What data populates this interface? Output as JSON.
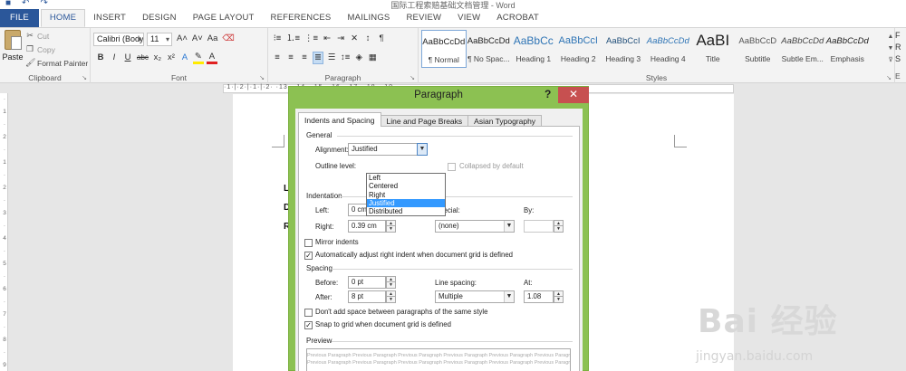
{
  "window": {
    "title": "国际工程索赔基础文档管理 - Word",
    "qat_icons": [
      "save-icon",
      "undo-icon",
      "redo-icon"
    ]
  },
  "ribbon_tabs": [
    "FILE",
    "HOME",
    "INSERT",
    "DESIGN",
    "PAGE LAYOUT",
    "REFERENCES",
    "MAILINGS",
    "REVIEW",
    "VIEW",
    "ACROBAT"
  ],
  "active_tab": "HOME",
  "clipboard": {
    "paste": "Paste",
    "cut": "Cut",
    "copy": "Copy",
    "format_painter": "Format Painter",
    "label": "Clipboard"
  },
  "font": {
    "name": "Calibri (Body)",
    "size": "11",
    "grow": "A˄",
    "shrink": "A˅",
    "case": "Aa",
    "bold": "B",
    "italic": "I",
    "underline": "U",
    "strike": "abc",
    "subscript": "x₂",
    "superscript": "x²",
    "label": "Font"
  },
  "paragraph": {
    "show_marks": "¶",
    "label": "Paragraph"
  },
  "styles": {
    "items": [
      {
        "preview": "AaBbCcDd",
        "name": "¶ Normal"
      },
      {
        "preview": "AaBbCcDd",
        "name": "¶ No Spac..."
      },
      {
        "preview": "AaBbCc",
        "name": "Heading 1"
      },
      {
        "preview": "AaBbCcI",
        "name": "Heading 2"
      },
      {
        "preview": "AaBbCcI",
        "name": "Heading 3"
      },
      {
        "preview": "AaBbCcDd",
        "name": "Heading 4"
      },
      {
        "preview": "AaBI",
        "name": "Title"
      },
      {
        "preview": "AaBbCcD",
        "name": "Subtitle"
      },
      {
        "preview": "AaBbCcDd",
        "name": "Subtle Em..."
      },
      {
        "preview": "AaBbCcDd",
        "name": "Emphasis"
      }
    ],
    "selected_index": 0,
    "label": "Styles"
  },
  "editing": {
    "find": "F",
    "replace": "R",
    "select": "S",
    "label": "E"
  },
  "ruler": {
    "numbers": "·1·|·2·|·1·|·2·   ·13· ·14· ·15· ·16· ·17· ·18· ·19"
  },
  "document": {
    "letters": [
      "Lo",
      "D",
      "R"
    ]
  },
  "dialog": {
    "title": "Paragraph",
    "help": "?",
    "close": "✕",
    "tabs": [
      "Indents and Spacing",
      "Line and Page Breaks",
      "Asian Typography"
    ],
    "active_tab_index": 0,
    "general": {
      "title": "General",
      "alignment_label": "Alignment:",
      "alignment_value": "Justified",
      "alignment_options": [
        "Left",
        "Centered",
        "Right",
        "Justified",
        "Distributed"
      ],
      "alignment_selected_index": 3,
      "outline_label": "Outline level:",
      "collapsed_label": "Collapsed by default"
    },
    "indentation": {
      "title": "Indentation",
      "left_label": "Left:",
      "left_value": "0 cm",
      "right_label": "Right:",
      "right_value": "0.39 cm",
      "special_label": "Special:",
      "special_value": "(none)",
      "by_label": "By:",
      "by_value": "",
      "mirror_label": "Mirror indents",
      "mirror_checked": false,
      "auto_adjust_label": "Automatically adjust right indent when document grid is defined",
      "auto_adjust_checked": true
    },
    "spacing": {
      "title": "Spacing",
      "before_label": "Before:",
      "before_value": "0 pt",
      "after_label": "After:",
      "after_value": "8 pt",
      "line_label": "Line spacing:",
      "line_value": "Multiple",
      "at_label": "At:",
      "at_value": "1.08",
      "dont_add_label": "Don't add space between paragraphs of the same style",
      "dont_add_checked": false,
      "snap_label": "Snap to grid when document grid is defined",
      "snap_checked": true
    },
    "preview": {
      "title": "Preview",
      "lines": [
        "Previous Paragraph Previous Paragraph Previous Paragraph Previous Paragraph Previous Paragraph Previous Paragraph",
        "Previous Paragraph Previous Paragraph Previous Paragraph Previous Paragraph Previous Paragraph Previous Paragraph"
      ]
    }
  },
  "watermark": {
    "logo": "Bai 经验",
    "url": "jingyan.baidu.com"
  },
  "colors": {
    "accent": "#2b579a",
    "dialog_frame": "#8cc152",
    "close": "#c75050",
    "selection": "#3399ff"
  }
}
